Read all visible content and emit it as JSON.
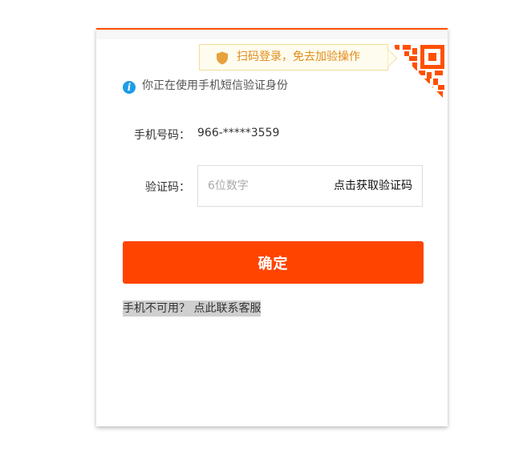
{
  "tooltip": {
    "text": "扫码登录，免去加验操作",
    "icon": "shield-icon",
    "color": "#e18a18"
  },
  "qr": {
    "icon": "qr-code-icon",
    "color": "#ff5000"
  },
  "info": {
    "icon": "info-icon",
    "text": "你正在使用手机短信验证身份"
  },
  "phone": {
    "label": "手机号码：",
    "value": "966-*****3559"
  },
  "code": {
    "label": "验证码：",
    "placeholder": "6位数字",
    "value": "",
    "get_code_label": "点击获取验证码"
  },
  "confirm": {
    "label": "确定",
    "color": "#ff4400"
  },
  "help": {
    "text": "手机不可用？ 点此联系客服"
  },
  "accent_color": "#ff5000"
}
